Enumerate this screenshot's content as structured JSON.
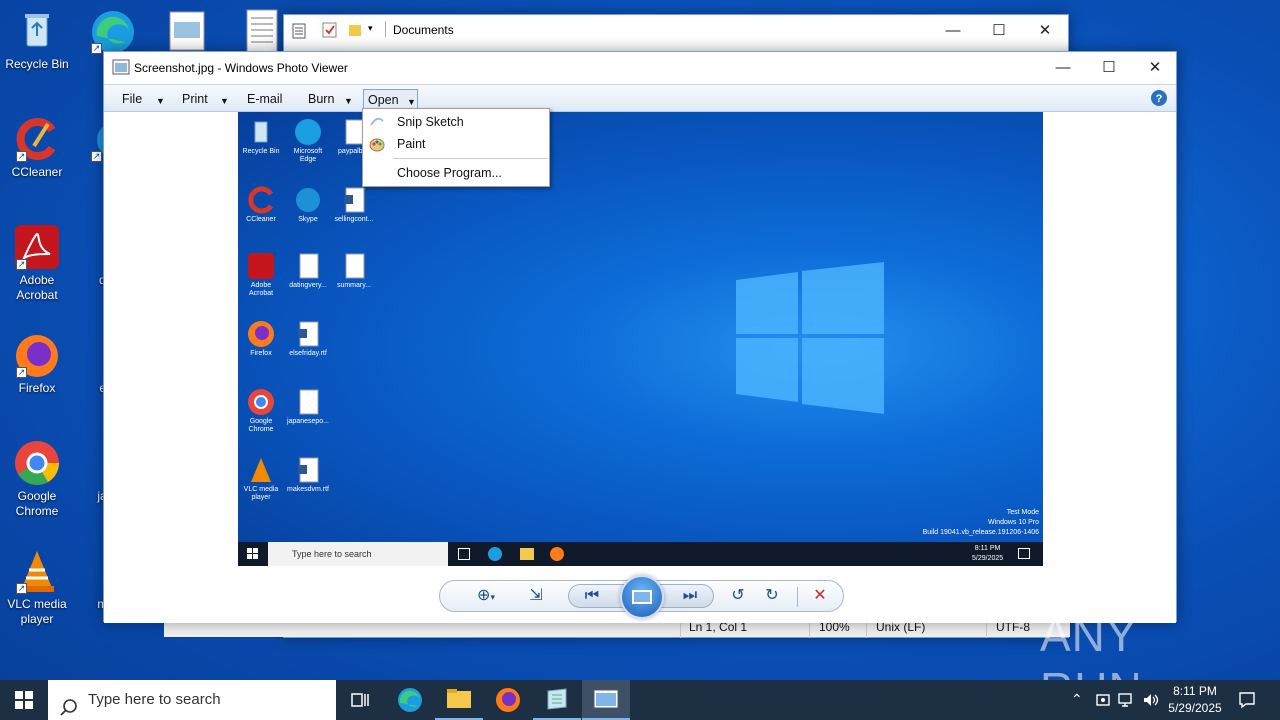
{
  "desktop": {
    "icons": [
      {
        "label": "Recycle Bin"
      },
      {
        "label": "Mi"
      },
      {
        "label": "CCleaner"
      },
      {
        "label": "S"
      },
      {
        "label": "Adobe Acrobat"
      },
      {
        "label": "datin"
      },
      {
        "label": "Firefox"
      },
      {
        "label": "elsef"
      },
      {
        "label": "Google Chrome"
      },
      {
        "label": "japan"
      },
      {
        "label": "VLC media player"
      },
      {
        "label": "make"
      }
    ]
  },
  "notepad": {
    "title": "Documents",
    "status": {
      "position": "Ln 1, Col 1",
      "zoom": "100%",
      "line_ending": "Unix (LF)",
      "encoding": "UTF-8"
    }
  },
  "photo_viewer": {
    "title": "Screenshot.jpg - Windows Photo Viewer",
    "menu": {
      "file": "File",
      "print": "Print",
      "email": "E-mail",
      "burn": "Burn",
      "open": "Open"
    },
    "open_menu": {
      "items": [
        "Snip  Sketch",
        "Paint"
      ],
      "choose": "Choose Program..."
    },
    "screenshot": {
      "icons": [
        "Recycle Bin",
        "Microsoft Edge",
        "paypalbi...",
        "CCleaner",
        "Skype",
        "sellingcont...",
        "Adobe Acrobat",
        "datingvery...",
        "summary...",
        "Firefox",
        "elsefriday.rtf",
        "Google Chrome",
        "japanesepo...",
        "VLC media player",
        "makesdvm.rtf"
      ],
      "watermark_lines": [
        "Test Mode",
        "Windows 10 Pro",
        "Build 19041.vb_release.191206-1406"
      ],
      "search_placeholder": "Type here to search",
      "time": "8:11 PM",
      "date": "5/29/2025"
    }
  },
  "taskbar": {
    "search_placeholder": "Type here to search",
    "time": "8:11 PM",
    "date": "5/29/2025"
  },
  "watermark": "ANY RUN",
  "colors": {
    "accent": "#0a64d2",
    "taskbar": "#1d2f43",
    "menubar": "#dfe9f5"
  }
}
